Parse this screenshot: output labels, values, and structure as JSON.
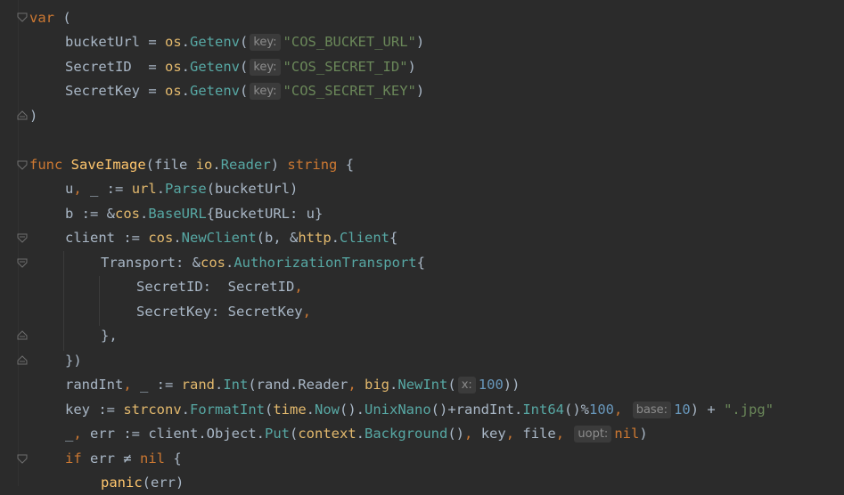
{
  "editor": {
    "hints": {
      "key": "key:",
      "x": "x:",
      "base": "base:",
      "uopt": "uopt:"
    },
    "t": {
      "var": "var",
      "paren_open": " (",
      "bucketUrl": "bucketUrl = ",
      "os": "os",
      "dot": ".",
      "Getenv": "Getenv",
      "lp": "(",
      "rp": ")",
      "s_bucket": "\"COS_BUCKET_URL\"",
      "SecretID_decl": "SecretID  = ",
      "s_secret_id": "\"COS_SECRET_ID\"",
      "SecretKey_decl": "SecretKey = ",
      "s_secret_key": "\"COS_SECRET_KEY\"",
      "close_paren": ")",
      "func": "func",
      "SaveImage": "SaveImage",
      "file_param": "(file ",
      "io": "io",
      "Reader": "Reader",
      "string": "string",
      "brace": " {",
      "u_decl": "u",
      "comma": ",",
      "u_rest": " _ := ",
      "url": "url",
      "Parse": "Parse",
      "bucketUrl_arg": "(bucketUrl)",
      "b_decl": "b := &",
      "cos": "cos",
      "BaseURL": "BaseURL",
      "BaseURL_rest": "{BucketURL: u}",
      "client_decl": "client := ",
      "NewClient": "NewClient",
      "nc_args": "(b, &",
      "http": "http",
      "Client": "Client",
      "lbrace": "{",
      "Transport": "Transport: &",
      "AuthorizationTransport": "AuthorizationTransport",
      "SecretID_field": "SecretID:  SecretID",
      "SecretKey_field": "SecretKey: SecretKey",
      "rbrace_comma": "},",
      "close_call": "})",
      "randInt_decl": "randInt",
      "ri_rest": " _ := ",
      "rand": "rand",
      "Int": "Int",
      "rand_reader": "(rand.Reader",
      "big": "big",
      "NewInt": "NewInt",
      "n100": "100",
      "rpp": "))",
      "key_decl": "key := ",
      "strconv": "strconv",
      "FormatInt": "FormatInt",
      "lp2": "(",
      "time": "time",
      "Now": "Now",
      "unixnano_sep": "().",
      "UnixNano": "UnixNano",
      "plus_randInt": "()+randInt.",
      "Int64": "Int64",
      "mod": "()%",
      "n10": "10",
      "plus": ") + ",
      "s_jpg": "\".jpg\"",
      "err_decl": "_",
      "err_rest": " err := client.Object.",
      "Put": "Put",
      "context": "context",
      "Background": "Background",
      "put_args": "() key",
      "file_arg": " file",
      "nil": "nil",
      "rp_end": ")",
      "if": "if",
      "err_neq": " err ≠ ",
      "nil_kw": "nil",
      "brace_open": " {",
      "panic": "panic",
      "err_arg": "(err)"
    }
  }
}
